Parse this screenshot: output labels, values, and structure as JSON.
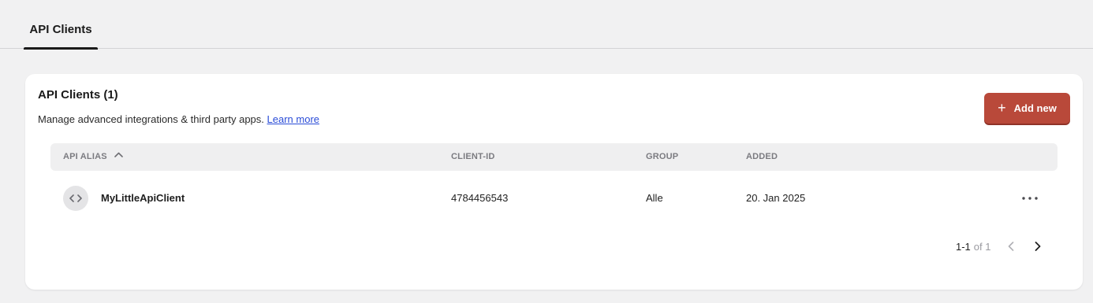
{
  "tabs": [
    {
      "label": "API Clients",
      "active": true
    }
  ],
  "card": {
    "title": "API Clients (1)",
    "description": "Manage advanced integrations & third party apps.",
    "learn_more": "Learn more",
    "add_button": "Add new"
  },
  "table": {
    "columns": {
      "alias": "API ALIAS",
      "client_id": "CLIENT-ID",
      "group": "GROUP",
      "added": "ADDED"
    },
    "sort": {
      "column": "alias",
      "direction": "ascending"
    },
    "rows": [
      {
        "alias": "MyLittleApiClient",
        "client_id": "4784456543",
        "group": "Alle",
        "added": "20. Jan 2025",
        "icon": "code-icon"
      }
    ]
  },
  "pagination": {
    "range": "1-1",
    "of": "of 1"
  },
  "colors": {
    "accent": "#b9493a",
    "link": "#2a4cd7",
    "background": "#f1f1f2"
  }
}
